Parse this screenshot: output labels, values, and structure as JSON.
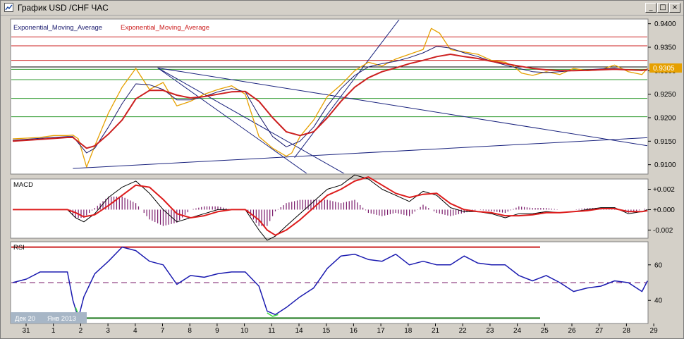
{
  "window": {
    "title": "График USD /CHF ЧАС",
    "controls": {
      "minimize": "_",
      "maximize": "□",
      "close": "×"
    }
  },
  "chart_data": [
    {
      "type": "line",
      "panel": "price",
      "legend": [
        "Exponential_Moving_Average",
        "Exponential_Moving_Average"
      ],
      "legend_colors": [
        "#1a1a6e",
        "#cc2020"
      ],
      "current_price_label": "0.9305",
      "ylim": [
        0.908,
        0.941
      ],
      "yticks": [
        "0.9400",
        "0.9350",
        "0.9300",
        "0.9250",
        "0.9200",
        "0.9150",
        "0.9100"
      ],
      "xtick_labels": [
        "31",
        "1",
        "2",
        "3",
        "4",
        "7",
        "8",
        "9",
        "10",
        "11",
        "14",
        "15",
        "16",
        "17",
        "18",
        "21",
        "22",
        "23",
        "24",
        "25",
        "26",
        "27",
        "28",
        "29"
      ],
      "date_labels": [
        "Дек 20",
        "Янв 2013"
      ],
      "horizontal_levels": [
        {
          "value": 0.9372,
          "color": "#cc2020"
        },
        {
          "value": 0.9353,
          "color": "#cc2020"
        },
        {
          "value": 0.9322,
          "color": "#cc2020"
        },
        {
          "value": 0.9308,
          "color": "#000000"
        },
        {
          "value": 0.9303,
          "color": "#2e9a2e"
        },
        {
          "value": 0.9281,
          "color": "#2e9a2e"
        },
        {
          "value": 0.9241,
          "color": "#2e9a2e"
        },
        {
          "value": 0.9202,
          "color": "#2e9a2e"
        }
      ],
      "series": [
        {
          "name": "price",
          "color": "#e6a000",
          "x": [
            0,
            1,
            1.5,
            2,
            2.2,
            2.4,
            2.7,
            3,
            3.5,
            4,
            4.5,
            5,
            5.5,
            6,
            6.5,
            7,
            7.5,
            8,
            8.5,
            9,
            9.5,
            10,
            10.2,
            10.5,
            11,
            11.5,
            12,
            12.5,
            13,
            13.5,
            14,
            14.5,
            15,
            15.3,
            15.6,
            16,
            16.5,
            17,
            17.5,
            18,
            18.3,
            18.6,
            19,
            19.5,
            20,
            20.5,
            21,
            21.5,
            22,
            22.5,
            23,
            23.2
          ],
          "values": [
            0.9155,
            0.9158,
            0.9162,
            0.9162,
            0.9163,
            0.9155,
            0.9095,
            0.914,
            0.921,
            0.9265,
            0.9305,
            0.926,
            0.9275,
            0.9225,
            0.9235,
            0.925,
            0.926,
            0.9268,
            0.925,
            0.916,
            0.9135,
            0.9118,
            0.9125,
            0.916,
            0.9195,
            0.9245,
            0.927,
            0.93,
            0.9318,
            0.931,
            0.9325,
            0.9335,
            0.9345,
            0.939,
            0.938,
            0.9345,
            0.934,
            0.9335,
            0.9322,
            0.9318,
            0.931,
            0.9295,
            0.929,
            0.9298,
            0.9292,
            0.9305,
            0.93,
            0.9302,
            0.9312,
            0.9298,
            0.9292,
            0.9305
          ]
        },
        {
          "name": "",
          "color": "#1a1a6e",
          "x": [
            0,
            1,
            2,
            2.2,
            2.7,
            3,
            3.5,
            4,
            4.5,
            5,
            5.5,
            6,
            6.5,
            7,
            7.5,
            8,
            8.5,
            9,
            9.5,
            10,
            10.5,
            11,
            11.5,
            12,
            12.5,
            13,
            13.5,
            14,
            14.5,
            15,
            15.5,
            16,
            16.5,
            17,
            17.5,
            18,
            18.5,
            19,
            19.5,
            20,
            20.5,
            21,
            21.5,
            22,
            22.5,
            23,
            23.2
          ],
          "values": [
            0.9152,
            0.9156,
            0.916,
            0.916,
            0.9125,
            0.9135,
            0.918,
            0.923,
            0.9272,
            0.927,
            0.926,
            0.9238,
            0.9238,
            0.9245,
            0.9255,
            0.9262,
            0.9255,
            0.9205,
            0.916,
            0.9138,
            0.915,
            0.918,
            0.9225,
            0.9262,
            0.929,
            0.9308,
            0.9315,
            0.932,
            0.9328,
            0.9338,
            0.9352,
            0.9348,
            0.9338,
            0.933,
            0.932,
            0.9312,
            0.9305,
            0.9298,
            0.9296,
            0.9298,
            0.93,
            0.9302,
            0.9304,
            0.9305,
            0.9302,
            0.93,
            0.9303
          ]
        },
        {
          "name": "",
          "color": "#cc2020",
          "x": [
            0,
            1,
            2,
            2.2,
            2.7,
            3,
            3.5,
            4,
            4.5,
            5,
            5.5,
            6,
            6.5,
            7,
            7.5,
            8,
            8.5,
            9,
            9.5,
            10,
            10.5,
            11,
            11.5,
            12,
            12.5,
            13,
            13.5,
            14,
            14.5,
            15,
            15.5,
            16,
            16.5,
            17,
            17.5,
            18,
            18.5,
            19,
            19.5,
            20,
            20.5,
            21,
            21.5,
            22,
            22.5,
            23,
            23.2
          ],
          "values": [
            0.915,
            0.9154,
            0.9158,
            0.9158,
            0.9135,
            0.914,
            0.9165,
            0.9195,
            0.924,
            0.9258,
            0.9258,
            0.9248,
            0.9242,
            0.9245,
            0.925,
            0.9255,
            0.9256,
            0.9235,
            0.92,
            0.917,
            0.9162,
            0.917,
            0.92,
            0.9235,
            0.9265,
            0.9285,
            0.9298,
            0.9306,
            0.9315,
            0.9322,
            0.933,
            0.9335,
            0.933,
            0.9326,
            0.932,
            0.9315,
            0.931,
            0.9305,
            0.9302,
            0.93,
            0.93,
            0.9301,
            0.9302,
            0.9303,
            0.9302,
            0.9301,
            0.9302
          ]
        }
      ],
      "trendlines": [
        {
          "from": [
            2.2,
            0.9092
          ],
          "to": [
            24.0,
            0.916
          ],
          "color": "#1a237e"
        },
        {
          "from": [
            5.3,
            0.9306
          ],
          "to": [
            24.0,
            0.9133
          ],
          "color": "#1a237e"
        },
        {
          "from": [
            5.3,
            0.9306
          ],
          "to": [
            10.9,
            0.9075
          ],
          "color": "#1a237e"
        },
        {
          "from": [
            5.3,
            0.9306
          ],
          "to": [
            12.3,
            0.9075
          ],
          "color": "#1a237e"
        },
        {
          "from": [
            10.3,
            0.9115
          ],
          "to": [
            14.4,
            0.943
          ],
          "color": "#1a237e"
        }
      ]
    },
    {
      "type": "line",
      "panel": "macd",
      "title": "MACD",
      "ylim": [
        -0.0028,
        0.003
      ],
      "yticks": [
        "+0.002",
        "+0.000",
        "-0.002"
      ],
      "histogram_color": "#7a1a6a",
      "series": [
        {
          "name": "",
          "color": "#000000",
          "x": [
            0,
            1,
            2,
            2.3,
            2.6,
            3,
            3.5,
            4,
            4.5,
            5,
            5.5,
            6,
            6.5,
            7,
            7.5,
            8,
            8.5,
            9,
            9.3,
            9.6,
            10,
            10.5,
            11,
            11.5,
            12,
            12.5,
            13,
            13.5,
            14,
            14.5,
            15,
            15.5,
            16,
            16.5,
            17,
            17.5,
            18,
            18.5,
            19,
            19.5,
            20,
            20.5,
            21,
            21.5,
            22,
            22.5,
            23,
            23.2
          ],
          "values": [
            0.0,
            0.0,
            0.0,
            -0.0008,
            -0.0012,
            -0.0004,
            0.0012,
            0.0022,
            0.0028,
            0.0016,
            0.0,
            -0.0012,
            -0.0008,
            -0.0004,
            0.0,
            0.0,
            0.0,
            -0.002,
            -0.003,
            -0.0026,
            -0.0016,
            -0.0004,
            0.0008,
            0.002,
            0.0024,
            0.0034,
            0.003,
            0.002,
            0.0014,
            0.0008,
            0.0018,
            0.0014,
            0.0002,
            -0.0002,
            -0.0002,
            -0.0004,
            -0.0008,
            -0.0004,
            -0.0004,
            -0.0002,
            -0.0003,
            -0.0002,
            0.0,
            0.0002,
            0.0002,
            -0.0004,
            -0.0002,
            0.0
          ]
        },
        {
          "name": "",
          "color": "#dd1c1c",
          "x": [
            0,
            1,
            2,
            2.3,
            2.6,
            3,
            3.5,
            4,
            4.5,
            5,
            5.5,
            6,
            6.5,
            7,
            7.5,
            8,
            8.5,
            9,
            9.3,
            9.6,
            10,
            10.5,
            11,
            11.5,
            12,
            12.5,
            13,
            13.5,
            14,
            14.5,
            15,
            15.5,
            16,
            16.5,
            17,
            17.5,
            18,
            18.5,
            19,
            19.5,
            20,
            20.5,
            21,
            21.5,
            22,
            22.5,
            23,
            23.2
          ],
          "values": [
            0.0,
            0.0,
            0.0,
            -0.0003,
            -0.0007,
            -0.0005,
            0.0004,
            0.0014,
            0.0024,
            0.0022,
            0.001,
            -0.0004,
            -0.0008,
            -0.0006,
            -0.0002,
            0.0,
            0.0,
            -0.001,
            -0.002,
            -0.0025,
            -0.002,
            -0.001,
            0.0002,
            0.0014,
            0.002,
            0.0028,
            0.0032,
            0.0024,
            0.0016,
            0.0012,
            0.0015,
            0.0016,
            0.0006,
            0.0,
            -0.0002,
            -0.0003,
            -0.0006,
            -0.0006,
            -0.0005,
            -0.0003,
            -0.0003,
            -0.0002,
            -0.0001,
            0.0001,
            0.0001,
            -0.0002,
            -0.0002,
            -0.0001
          ]
        }
      ]
    },
    {
      "type": "line",
      "panel": "rsi",
      "title": "RSI",
      "ylim": [
        27,
        73
      ],
      "yticks": [
        "60",
        "40"
      ],
      "levels": [
        {
          "value": 70,
          "color": "#cc2020"
        },
        {
          "value": 50,
          "color": "#7a1a6a"
        },
        {
          "value": 30,
          "color": "#1f7a1f"
        }
      ],
      "series": [
        {
          "name": "",
          "color": "#1b1bb0",
          "x": [
            0,
            0.5,
            1,
            1.5,
            2,
            2.2,
            2.4,
            2.6,
            3,
            3.5,
            4,
            4.5,
            5,
            5.5,
            6,
            6.5,
            7,
            7.5,
            8,
            8.5,
            9,
            9.3,
            9.6,
            10,
            10.5,
            11,
            11.5,
            12,
            12.5,
            13,
            13.5,
            14,
            14.5,
            15,
            15.5,
            16,
            16.5,
            17,
            17.5,
            18,
            18.5,
            19,
            19.5,
            20,
            20.5,
            21,
            21.5,
            22,
            22.5,
            23,
            23.2
          ],
          "values": [
            50,
            52,
            56,
            56,
            56,
            40,
            30,
            42,
            55,
            62,
            70,
            68,
            62,
            60,
            49,
            54,
            53,
            55,
            56,
            56,
            48,
            34,
            32,
            36,
            42,
            47,
            58,
            65,
            66,
            63,
            62,
            66,
            60,
            62,
            60,
            60,
            65,
            61,
            60,
            60,
            54,
            51,
            54,
            50,
            45,
            47,
            48,
            51,
            50,
            45,
            51
          ]
        },
        {
          "name": "",
          "color": "#3cdc3c",
          "x": [
            2.3,
            2.45,
            2.6,
            9.3,
            9.5,
            9.7
          ],
          "values": [
            36,
            30,
            32,
            33,
            31,
            32
          ],
          "segments": [
            [
              0,
              3
            ],
            [
              3,
              6
            ]
          ]
        }
      ]
    }
  ]
}
